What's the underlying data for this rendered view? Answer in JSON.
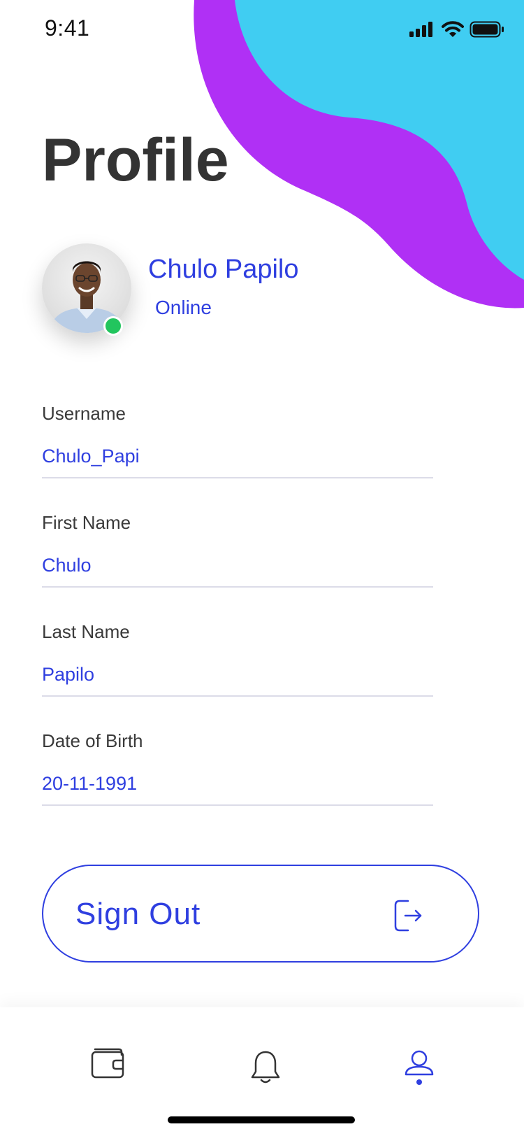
{
  "status_bar": {
    "time": "9:41"
  },
  "header": {
    "title": "Profile"
  },
  "profile": {
    "name": "Chulo Papilo",
    "status": "Online"
  },
  "fields": [
    {
      "label": "Username",
      "value": "Chulo_Papi"
    },
    {
      "label": "First Name",
      "value": "Chulo"
    },
    {
      "label": "Last Name",
      "value": "Papilo"
    },
    {
      "label": "Date of Birth",
      "value": "20-11-1991"
    }
  ],
  "signout": {
    "label": "Sign Out",
    "icon": "logout-icon"
  },
  "tabbar": {
    "items": [
      {
        "icon": "wallet-icon",
        "active": false
      },
      {
        "icon": "bell-icon",
        "active": false
      },
      {
        "icon": "profile-icon",
        "active": true
      }
    ]
  },
  "colors": {
    "accent": "#2f3fe0",
    "blob_purple": "#b030f5",
    "blob_cyan": "#40cdf2",
    "online": "#22c55e",
    "title": "#333333"
  }
}
